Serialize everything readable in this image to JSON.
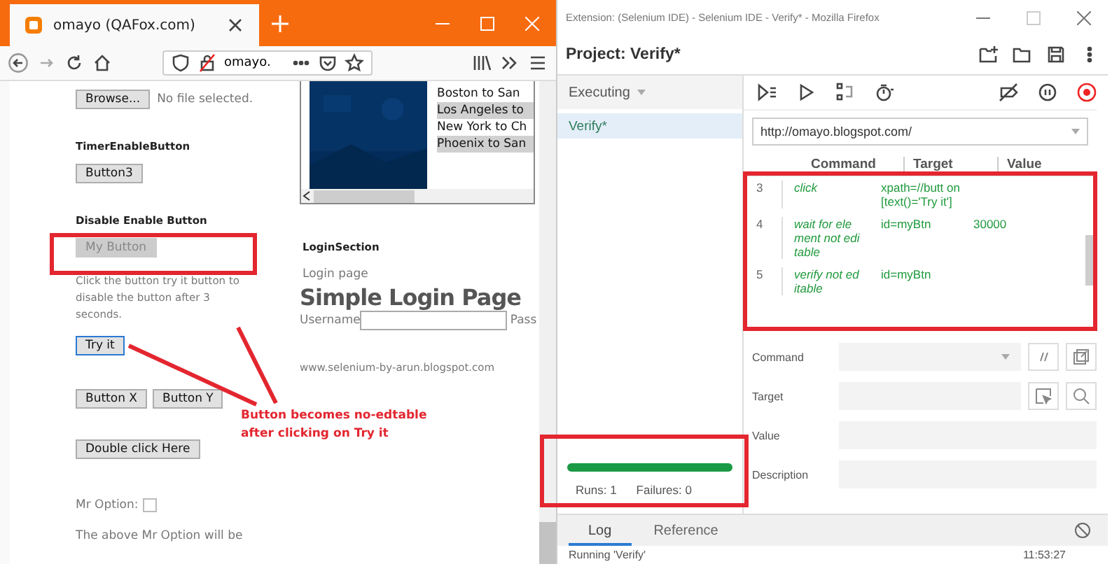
{
  "browser": {
    "tab_title": "omayo (QAFox.com)",
    "address": "omayo."
  },
  "page": {
    "file": {
      "button": "Browse...",
      "status": "No file selected."
    },
    "list_items": [
      {
        "label": "Boston to San",
        "selected": false
      },
      {
        "label": "Los Angeles to",
        "selected": true
      },
      {
        "label": "New York to Ch",
        "selected": false
      },
      {
        "label": "Phoenix to San",
        "selected": true
      }
    ],
    "timer": {
      "heading": "TimerEnableButton",
      "button": "Button3"
    },
    "disable": {
      "heading": "Disable Enable Button",
      "button": "My Button",
      "disabled": true,
      "text": "Click the button try it button to disable the button after 3 seconds.",
      "try_button": "Try it"
    },
    "buttons": [
      "Button X",
      "Button Y"
    ],
    "double_button": "Double click Here",
    "option": {
      "label": "Mr Option:",
      "checked": false
    },
    "note": "The above Mr Option will be",
    "login": {
      "section": "LoginSection",
      "caption": "Login page",
      "title": "Simple Login Page",
      "username_label": "Username",
      "password_label": "Pass"
    },
    "footer": "www.selenium-by-arun.blogspot.com"
  },
  "ide": {
    "window_title": "Extension: (Selenium IDE) - Selenium IDE - Verify* - Mozilla Firefox",
    "project": "Project: Verify*",
    "sidebar": {
      "dropdown": "Executing",
      "tests": [
        {
          "label": "Verify*",
          "selected": true
        }
      ],
      "progress": {
        "level": 1.0
      },
      "runs": "Runs: 1",
      "failures": "Failures: 0"
    },
    "url": "http://omayo.blogspot.com/",
    "columns": [
      "Command",
      "Target",
      "Value"
    ],
    "rows": [
      {
        "index": "3",
        "command": "click",
        "target": "xpath=//butt on[text()='Try it']",
        "value": ""
      },
      {
        "index": "4",
        "command": "wait for ele ment not edi table",
        "target": "id=myBtn",
        "value": "30000"
      },
      {
        "index": "5",
        "command": "verify not ed itable",
        "target": "id=myBtn",
        "value": ""
      }
    ],
    "form": [
      {
        "label": "Command",
        "kind": "select"
      },
      {
        "label": "Target",
        "kind": "target"
      },
      {
        "label": "Value",
        "kind": "text"
      },
      {
        "label": "Description",
        "kind": "text"
      }
    ],
    "tabs": [
      {
        "label": "Log",
        "selected": true
      },
      {
        "label": "Reference",
        "selected": false
      }
    ],
    "log": {
      "message": "Running 'Verify'",
      "time": "11:53:27"
    }
  },
  "annotation": "Button becomes no-edtable after clicking on Try it"
}
